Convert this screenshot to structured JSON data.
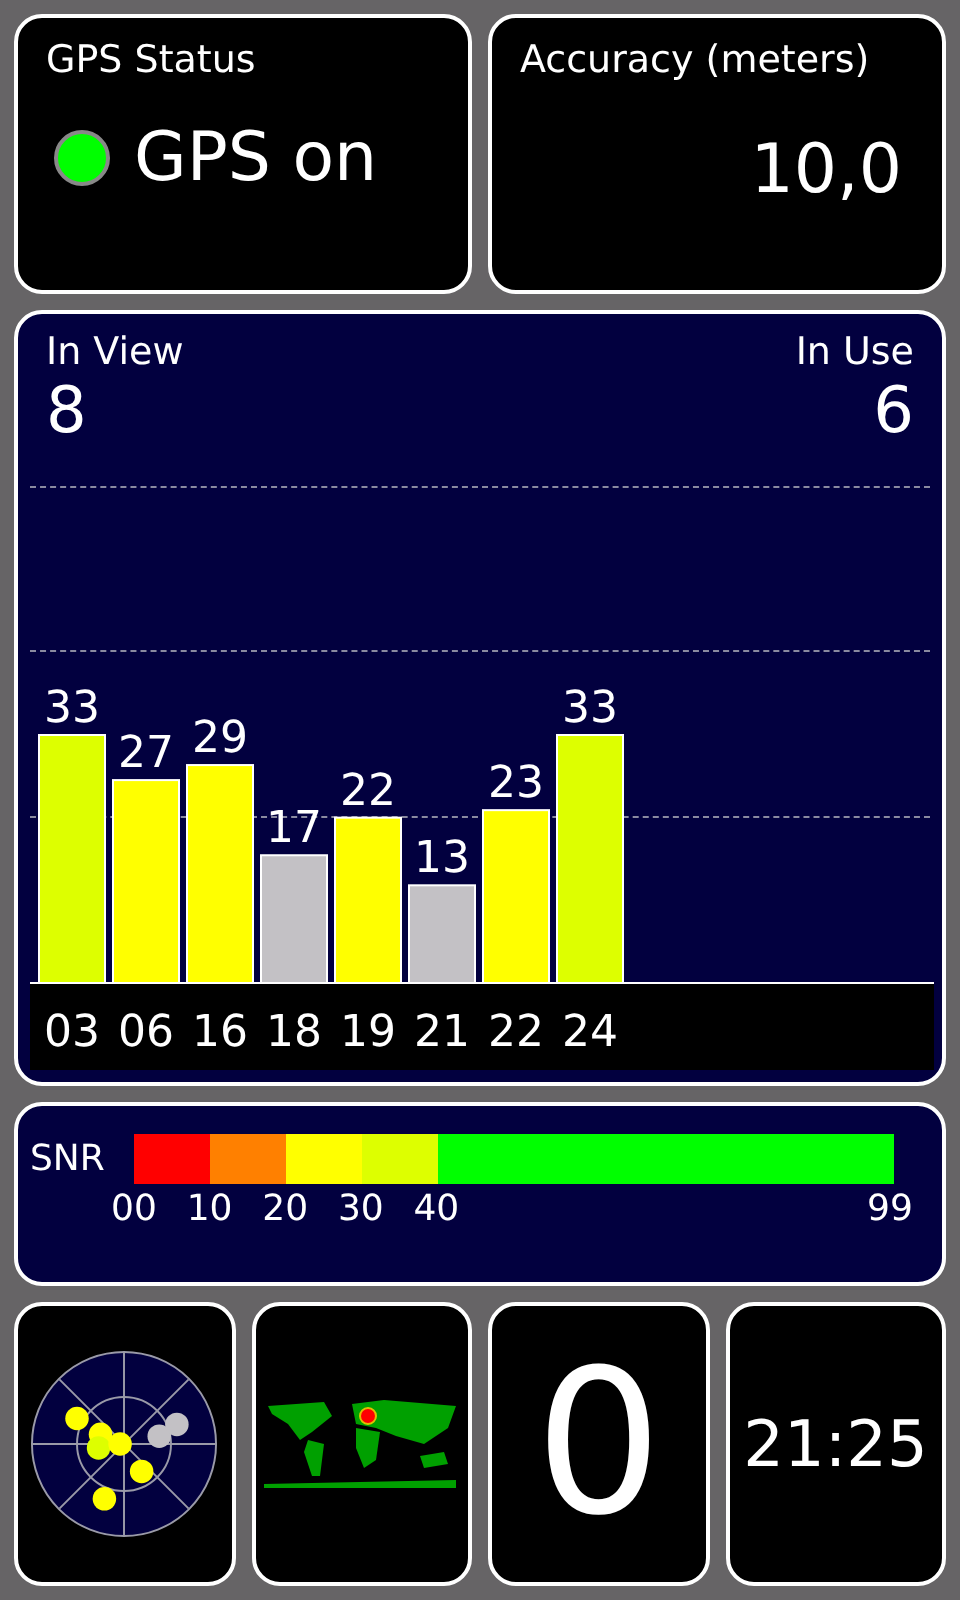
{
  "status": {
    "title": "GPS Status",
    "label": "GPS on",
    "on": true
  },
  "accuracy": {
    "title": "Accuracy (meters)",
    "value": "10,0"
  },
  "satellites": {
    "in_view_label": "In View",
    "in_view": "8",
    "in_use_label": "In Use",
    "in_use": "6",
    "chart_data": {
      "type": "bar",
      "categories": [
        "03",
        "06",
        "16",
        "18",
        "19",
        "21",
        "22",
        "24"
      ],
      "data_labels": true,
      "series": [
        {
          "color": "#ddff00",
          "values": [
            33,
            null,
            null,
            null,
            null,
            null,
            null,
            33
          ]
        },
        {
          "color": "#ffff00",
          "values": [
            null,
            27,
            29,
            null,
            22,
            null,
            23,
            null
          ]
        },
        {
          "color": "#c3c1c5",
          "values": [
            null,
            null,
            null,
            17,
            null,
            13,
            null,
            null
          ]
        }
      ]
    }
  },
  "snr_legend": {
    "label": "SNR",
    "segments": [
      {
        "color": "#ff0000"
      },
      {
        "color": "#ff8000"
      },
      {
        "color": "#ffff00"
      },
      {
        "color": "#ddff00"
      },
      {
        "color": "#00ff00"
      }
    ],
    "ticks": [
      "00",
      "10",
      "20",
      "30",
      "40",
      "99"
    ]
  },
  "tiles": {
    "count": "0",
    "time": "21:25"
  }
}
